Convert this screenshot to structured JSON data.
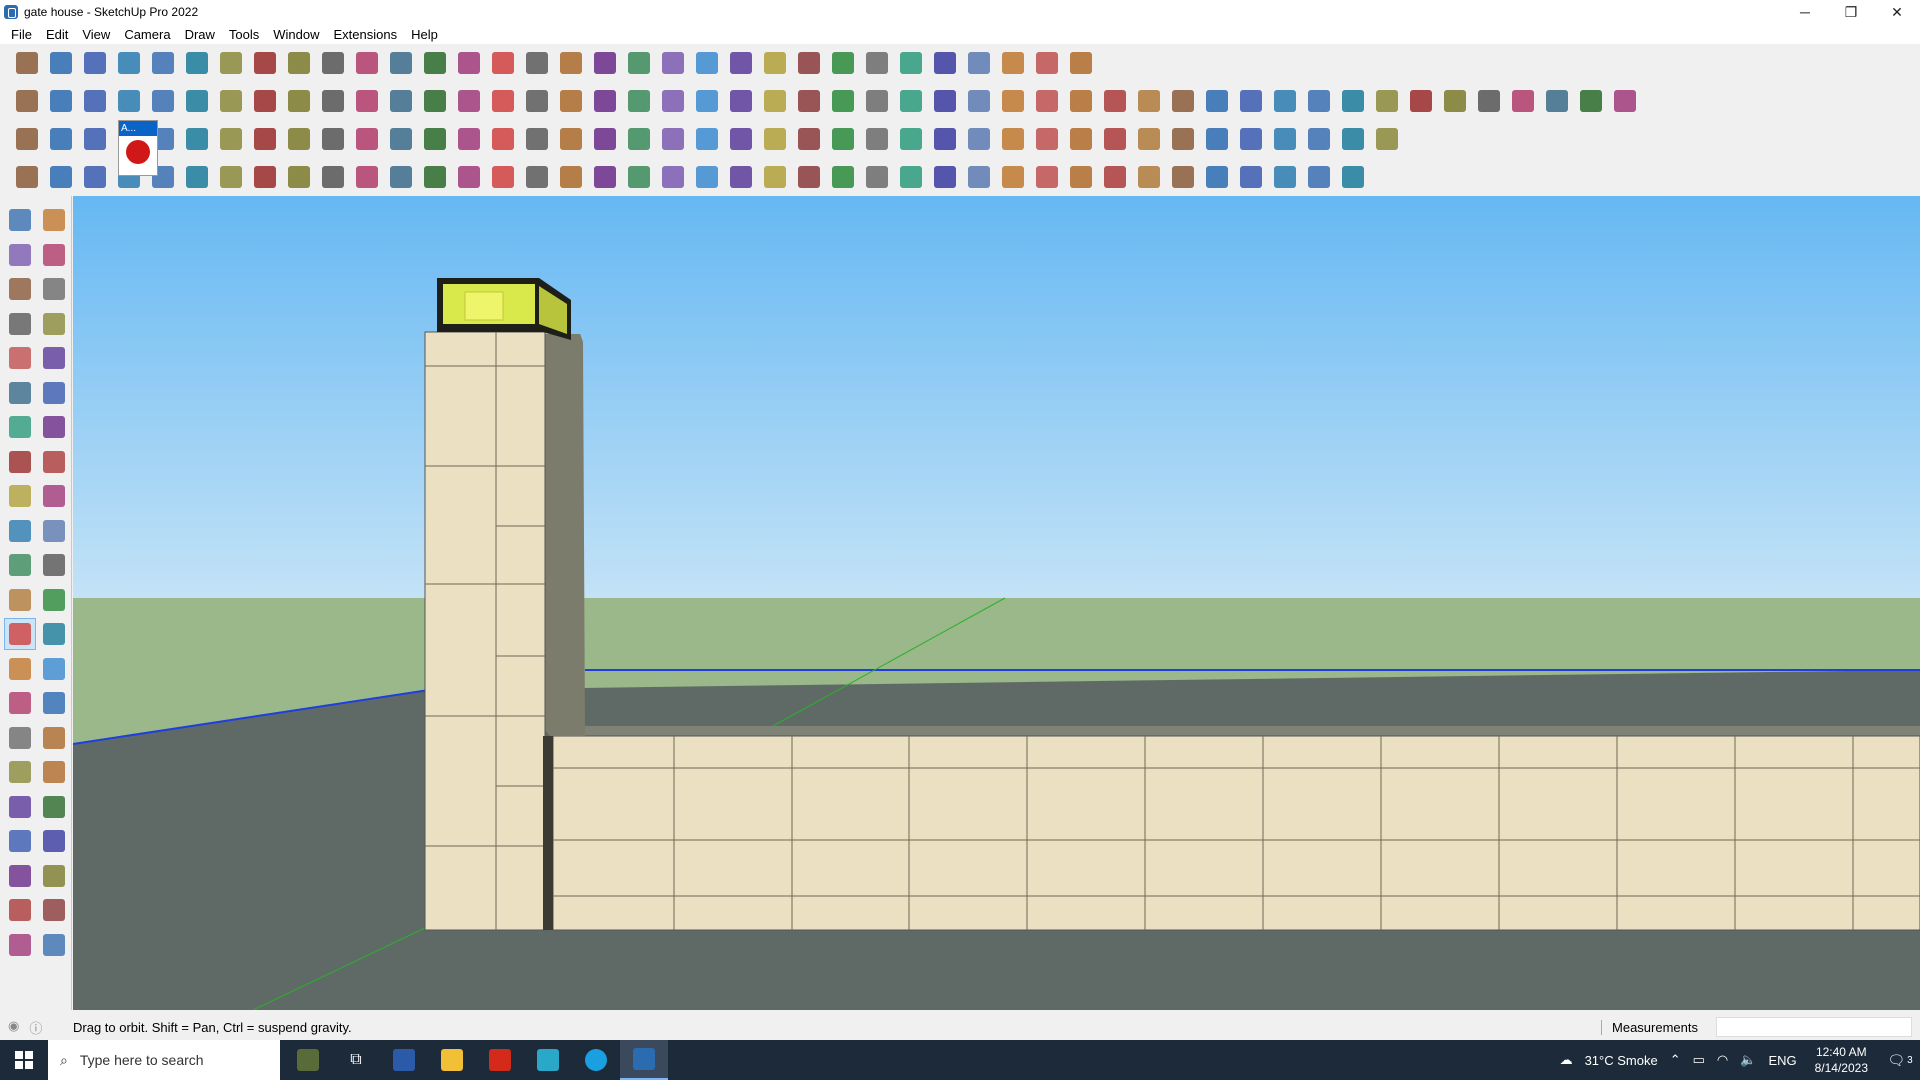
{
  "window": {
    "title": "gate house - SketchUp Pro 2022",
    "controls": [
      "─",
      "❐",
      "✕"
    ]
  },
  "menubar": {
    "items": [
      "File",
      "Edit",
      "View",
      "Camera",
      "Draw",
      "Tools",
      "Window",
      "Extensions",
      "Help"
    ]
  },
  "toolbar": {
    "tooltip_tab_label": "A..."
  },
  "status": {
    "hint": "Drag to orbit. Shift = Pan, Ctrl = suspend gravity.",
    "measurements_label": "Measurements",
    "measurements_value": ""
  },
  "taskbar": {
    "search_placeholder": "Type here to search",
    "weather": "31°C  Smoke",
    "language": "ENG",
    "time": "12:40 AM",
    "date": "8/14/2023",
    "notification_count": "3"
  },
  "colors": {
    "sky_top": "#66b8f3",
    "sky_bottom": "#bfe0f5",
    "ground": "#9ab88a",
    "floor": "#5f6a66",
    "stone": "#ece0c3",
    "glass": "#d9e84a",
    "axis_blue": "#1d3fe0",
    "axis_green": "#2bb02b"
  }
}
